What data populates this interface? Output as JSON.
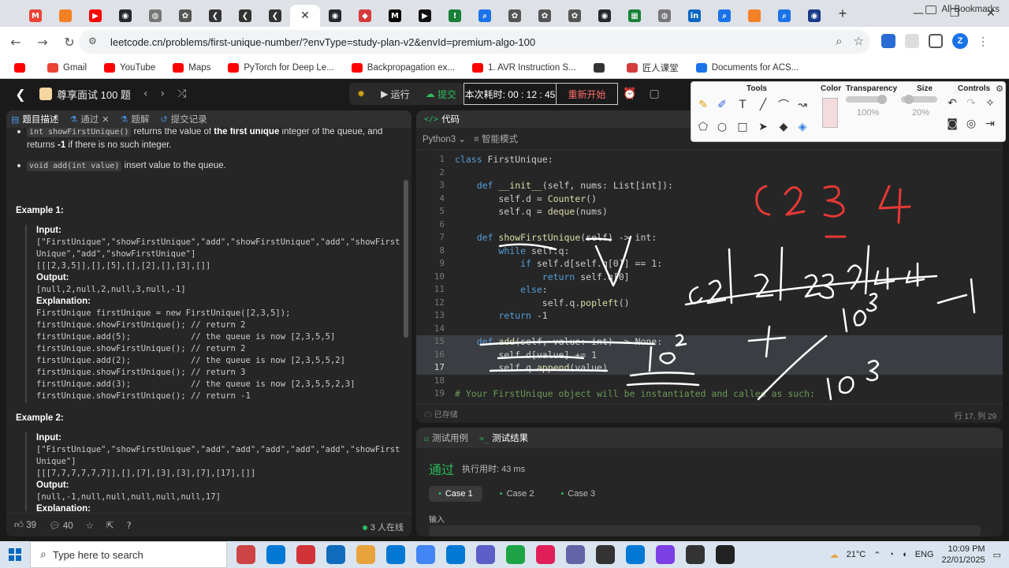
{
  "browser": {
    "tabs": [
      {
        "icon": "gmail-icon",
        "color": "#ea4335",
        "glyph": "M"
      },
      {
        "icon": "box-icon",
        "color": "#f48024",
        "glyph": ""
      },
      {
        "icon": "youtube-icon",
        "color": "#ff0000",
        "glyph": "▶"
      },
      {
        "icon": "github-icon",
        "color": "#24292e",
        "glyph": "◉"
      },
      {
        "icon": "globe-icon",
        "color": "#777777",
        "glyph": "◍"
      },
      {
        "icon": "chatgpt-icon",
        "color": "#555555",
        "glyph": "✿"
      },
      {
        "icon": "leetcode-icon",
        "color": "#333333",
        "glyph": "❮"
      },
      {
        "icon": "leetcode-icon",
        "color": "#333333",
        "glyph": "❮"
      },
      {
        "icon": "leetcode-icon",
        "color": "#333333",
        "glyph": "❮"
      },
      {
        "icon": "leetcode-icon",
        "color": "#333333",
        "glyph": "❮",
        "active": true
      },
      {
        "icon": "github-icon",
        "color": "#24292e",
        "glyph": "◉"
      },
      {
        "icon": "shield-icon",
        "color": "#d63b3b",
        "glyph": "◆"
      },
      {
        "icon": "medium-icon",
        "color": "#000000",
        "glyph": "M"
      },
      {
        "icon": "play-icon",
        "color": "#111111",
        "glyph": "▶"
      },
      {
        "icon": "doc-icon",
        "color": "#188038",
        "glyph": "!"
      },
      {
        "icon": "search-icon",
        "color": "#1a73e8",
        "glyph": "⌕"
      },
      {
        "icon": "chatgpt-icon",
        "color": "#555555",
        "glyph": "✿"
      },
      {
        "icon": "chatgpt-icon",
        "color": "#555555",
        "glyph": "✿"
      },
      {
        "icon": "chatgpt-icon",
        "color": "#555555",
        "glyph": "✿"
      },
      {
        "icon": "github-icon",
        "color": "#24292e",
        "glyph": "◉"
      },
      {
        "icon": "sheet-icon",
        "color": "#188038",
        "glyph": "▦"
      },
      {
        "icon": "globe-icon",
        "color": "#777777",
        "glyph": "◍"
      },
      {
        "icon": "linkedin-icon",
        "color": "#0a66c2",
        "glyph": "in"
      },
      {
        "icon": "search-icon",
        "color": "#1a73e8",
        "glyph": "⌕"
      },
      {
        "icon": "box-icon",
        "color": "#f48024",
        "glyph": ""
      },
      {
        "icon": "search-icon",
        "color": "#1a73e8",
        "glyph": "⌕"
      },
      {
        "icon": "globe-icon",
        "color": "#1a3a8a",
        "glyph": "◉"
      }
    ],
    "url": "leetcode.cn/problems/first-unique-number/?envType=study-plan-v2&envId=premium-algo-100",
    "profile_initial": "Z",
    "bookmarks": [
      {
        "label": "",
        "color": "#ff0000"
      },
      {
        "label": "Gmail",
        "color": "#ea4335"
      },
      {
        "label": "YouTube",
        "color": "#ff0000"
      },
      {
        "label": "Maps",
        "color": "#ff0000"
      },
      {
        "label": "PyTorch for Deep Le...",
        "color": "#ff0000"
      },
      {
        "label": "Backpropagation ex...",
        "color": "#ff0000"
      },
      {
        "label": "1. AVR Instruction S...",
        "color": "#ff0000"
      },
      {
        "label": "",
        "color": "#333333"
      },
      {
        "label": "匠人课堂",
        "color": "#d63b3b"
      },
      {
        "label": "Documents for ACS...",
        "color": "#1a73e8"
      }
    ],
    "all_bookmarks": "All Bookmarks"
  },
  "lc_header": {
    "study_plan": "尊享面试 100 题",
    "debug": "",
    "run": "运行",
    "submit": "提交",
    "timer_label": "本次耗时: 00 : 12 : 45",
    "restart": "重新开始"
  },
  "left": {
    "tabs": [
      "题目描述",
      "通过",
      "题解",
      "提交记录"
    ],
    "bullets": [
      {
        "code": "int showFirstUnique()",
        "text_a": " returns the value of ",
        "bold": "the first unique",
        "text_b": " integer of the queue, and returns ",
        "bold2": "-1",
        "text_c": " if there is no such integer."
      },
      {
        "code": "void add(int value)",
        "text_a": " insert value to the queue.",
        "bold": "",
        "text_b": "",
        "bold2": "",
        "text_c": ""
      }
    ],
    "example1": {
      "title": "Example 1:",
      "input_label": "Input:",
      "input": "[\"FirstUnique\",\"showFirstUnique\",\"add\",\"showFirstUnique\",\"add\",\"showFirst\nUnique\",\"add\",\"showFirstUnique\"]\n[[[2,3,5]],[],[5],[],[2],[],[3],[]]",
      "output_label": "Output:",
      "output": "[null,2,null,2,null,3,null,-1]",
      "expl_label": "Explanation:",
      "expl": "FirstUnique firstUnique = new FirstUnique([2,3,5]);\nfirstUnique.showFirstUnique(); // return 2\nfirstUnique.add(5);            // the queue is now [2,3,5,5]\nfirstUnique.showFirstUnique(); // return 2\nfirstUnique.add(2);            // the queue is now [2,3,5,5,2]\nfirstUnique.showFirstUnique(); // return 3\nfirstUnique.add(3);            // the queue is now [2,3,5,5,2,3]\nfirstUnique.showFirstUnique(); // return -1"
    },
    "example2": {
      "title": "Example 2:",
      "input_label": "Input:",
      "input": "[\"FirstUnique\",\"showFirstUnique\",\"add\",\"add\",\"add\",\"add\",\"add\",\"showFirst\nUnique\"]\n[[[7,7,7,7,7,7]],[],[7],[3],[3],[7],[17],[]]",
      "output_label": "Output:",
      "output": "[null,-1,null,null,null,null,null,17]",
      "expl_label": "Explanation:"
    },
    "footer": {
      "likes": "39",
      "comments": "40",
      "online": "3 人在线"
    }
  },
  "code": {
    "tab": "代码",
    "language": "Python3",
    "mode": "智能模式",
    "lines": [
      {
        "n": "1",
        "t": "class FirstUnique:"
      },
      {
        "n": "2",
        "t": ""
      },
      {
        "n": "3",
        "t": "    def __init__(self, nums: List[int]):"
      },
      {
        "n": "4",
        "t": "        self.d = Counter()"
      },
      {
        "n": "5",
        "t": "        self.q = deque(nums)"
      },
      {
        "n": "6",
        "t": ""
      },
      {
        "n": "7",
        "t": "    def showFirstUnique(self) -> int:"
      },
      {
        "n": "8",
        "t": "        while self.q:"
      },
      {
        "n": "9",
        "t": "            if self.d[self.q[0]] == 1:"
      },
      {
        "n": "10",
        "t": "                return self.q[0]"
      },
      {
        "n": "11",
        "t": "            else:"
      },
      {
        "n": "12",
        "t": "                self.q.popleft()"
      },
      {
        "n": "13",
        "t": "        return -1"
      },
      {
        "n": "14",
        "t": ""
      },
      {
        "n": "15",
        "t": "    def add(self, value: int) -> None:"
      },
      {
        "n": "16",
        "t": "        self.d[value] += 1"
      },
      {
        "n": "17",
        "t": "        self.q.append(value)"
      },
      {
        "n": "18",
        "t": ""
      },
      {
        "n": "19",
        "t": "# Your FirstUnique object will be instantiated and called as such:"
      }
    ],
    "saved": "已存储",
    "cursor": "行 17, 列 29"
  },
  "draw_tool": {
    "tools": "Tools",
    "color": "Color",
    "transparency": "Transparency",
    "transparency_val": "100%",
    "size": "Size",
    "size_val": "20%",
    "controls": "Controls"
  },
  "results": {
    "tab_cases": "测试用例",
    "tab_results": "测试结果",
    "status": "通过",
    "time": "执行用时: 43 ms",
    "cases": [
      "Case 1",
      "Case 2",
      "Case 3"
    ],
    "input_label": "输入"
  },
  "taskbar": {
    "search": "Type here to search",
    "apps": [
      "#c44",
      "#0078d4",
      "#d13438",
      "#0f6cbd",
      "#e8a33d",
      "#0078d4",
      "#4285f4",
      "#0078d4",
      "#5b5fc7",
      "#1ea446",
      "#e01e5a",
      "#6264a7",
      "#333333",
      "#0078d4",
      "#7b3fe4",
      "#333333",
      "#222222"
    ],
    "weather": "21°C",
    "lang": "ENG",
    "time": "10:09 PM",
    "date": "22/01/2025"
  }
}
